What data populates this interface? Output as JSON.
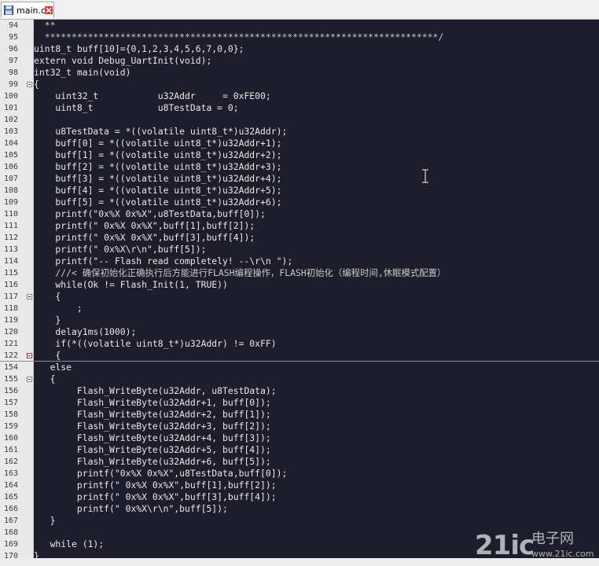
{
  "tab": {
    "title": "main.c",
    "file_icon": "floppy-disk-icon",
    "close_icon": "close-icon"
  },
  "lines": [
    {
      "n": "94",
      "t": "  **",
      "fold": null,
      "style": "comment"
    },
    {
      "n": "95",
      "t": "  *************************************************************************/",
      "fold": null,
      "style": "comment"
    },
    {
      "n": "96",
      "t": "uint8_t buff[10]={0,1,2,3,4,5,6,7,0,0};",
      "fold": null,
      "style": ""
    },
    {
      "n": "97",
      "t": "extern void Debug_UartInit(void);",
      "fold": null,
      "style": ""
    },
    {
      "n": "98",
      "t": "int32_t main(void)",
      "fold": null,
      "style": ""
    },
    {
      "n": "99",
      "t": "{",
      "fold": "minus",
      "style": ""
    },
    {
      "n": "100",
      "t": "    uint32_t           u32Addr     = 0xFE00;",
      "fold": null,
      "style": ""
    },
    {
      "n": "101",
      "t": "    uint8_t            u8TestData = 0;",
      "fold": null,
      "style": ""
    },
    {
      "n": "102",
      "t": "",
      "fold": null,
      "style": ""
    },
    {
      "n": "103",
      "t": "    u8TestData = *((volatile uint8_t*)u32Addr);",
      "fold": null,
      "style": ""
    },
    {
      "n": "104",
      "t": "    buff[0] = *((volatile uint8_t*)u32Addr+1);",
      "fold": null,
      "style": ""
    },
    {
      "n": "105",
      "t": "    buff[1] = *((volatile uint8_t*)u32Addr+2);",
      "fold": null,
      "style": ""
    },
    {
      "n": "106",
      "t": "    buff[2] = *((volatile uint8_t*)u32Addr+3);",
      "fold": null,
      "style": ""
    },
    {
      "n": "107",
      "t": "    buff[3] = *((volatile uint8_t*)u32Addr+4);",
      "fold": null,
      "style": ""
    },
    {
      "n": "108",
      "t": "    buff[4] = *((volatile uint8_t*)u32Addr+5);",
      "fold": null,
      "style": ""
    },
    {
      "n": "109",
      "t": "    buff[5] = *((volatile uint8_t*)u32Addr+6);",
      "fold": null,
      "style": ""
    },
    {
      "n": "110",
      "t": "    printf(\"0x%X 0x%X\",u8TestData,buff[0]);",
      "fold": null,
      "style": ""
    },
    {
      "n": "111",
      "t": "    printf(\" 0x%X 0x%X\",buff[1],buff[2]);",
      "fold": null,
      "style": ""
    },
    {
      "n": "112",
      "t": "    printf(\" 0x%X 0x%X\",buff[3],buff[4]);",
      "fold": null,
      "style": ""
    },
    {
      "n": "113",
      "t": "    printf(\" 0x%X\\r\\n\",buff[5]);",
      "fold": null,
      "style": ""
    },
    {
      "n": "114",
      "t": "    printf(\"-- Flash read completely! --\\r\\n \");",
      "fold": null,
      "style": ""
    },
    {
      "n": "115",
      "t": "    ///< 确保初始化正确执行后方能进行FLASH编程操作，FLASH初始化（编程时间,休眠模式配置）",
      "fold": null,
      "style": "comment"
    },
    {
      "n": "116",
      "t": "    while(Ok != Flash_Init(1, TRUE))",
      "fold": null,
      "style": ""
    },
    {
      "n": "117",
      "t": "    {",
      "fold": "minus",
      "style": ""
    },
    {
      "n": "118",
      "t": "        ;",
      "fold": null,
      "style": ""
    },
    {
      "n": "119",
      "t": "    }",
      "fold": null,
      "style": ""
    },
    {
      "n": "120",
      "t": "    delay1ms(1000);",
      "fold": null,
      "style": ""
    },
    {
      "n": "121",
      "t": "    if(*((volatile uint8_t*)u32Addr) != 0xFF)",
      "fold": null,
      "style": ""
    },
    {
      "n": "122",
      "t": "    {",
      "fold": "red",
      "style": ""
    },
    {
      "n": "154",
      "t": "   else",
      "fold": null,
      "style": ""
    },
    {
      "n": "155",
      "t": "   {",
      "fold": "minus",
      "style": ""
    },
    {
      "n": "156",
      "t": "        Flash_WriteByte(u32Addr, u8TestData);",
      "fold": null,
      "style": ""
    },
    {
      "n": "157",
      "t": "        Flash_WriteByte(u32Addr+1, buff[0]);",
      "fold": null,
      "style": ""
    },
    {
      "n": "158",
      "t": "        Flash_WriteByte(u32Addr+2, buff[1]);",
      "fold": null,
      "style": ""
    },
    {
      "n": "159",
      "t": "        Flash_WriteByte(u32Addr+3, buff[2]);",
      "fold": null,
      "style": ""
    },
    {
      "n": "160",
      "t": "        Flash_WriteByte(u32Addr+4, buff[3]);",
      "fold": null,
      "style": ""
    },
    {
      "n": "161",
      "t": "        Flash_WriteByte(u32Addr+5, buff[4]);",
      "fold": null,
      "style": ""
    },
    {
      "n": "162",
      "t": "        Flash_WriteByte(u32Addr+6, buff[5]);",
      "fold": null,
      "style": ""
    },
    {
      "n": "163",
      "t": "        printf(\"0x%X 0x%X\",u8TestData,buff[0]);",
      "fold": null,
      "style": ""
    },
    {
      "n": "164",
      "t": "        printf(\" 0x%X 0x%X\",buff[1],buff[2]);",
      "fold": null,
      "style": ""
    },
    {
      "n": "165",
      "t": "        printf(\" 0x%X 0x%X\",buff[3],buff[4]);",
      "fold": null,
      "style": ""
    },
    {
      "n": "166",
      "t": "        printf(\" 0x%X\\r\\n\",buff[5]);",
      "fold": null,
      "style": ""
    },
    {
      "n": "167",
      "t": "   }",
      "fold": null,
      "style": ""
    },
    {
      "n": "168",
      "t": "",
      "fold": null,
      "style": ""
    },
    {
      "n": "169",
      "t": "   while (1);",
      "fold": null,
      "style": ""
    },
    {
      "n": "170",
      "t": "}",
      "fold": null,
      "style": ""
    }
  ],
  "watermark": {
    "logo": "21ic",
    "cn": "电子网",
    "url": "www.21ic.com"
  },
  "colors": {
    "editor_bg": "#1d1d2c",
    "text": "#e8e8e8",
    "gutter_bg": "#e9e9e9"
  }
}
